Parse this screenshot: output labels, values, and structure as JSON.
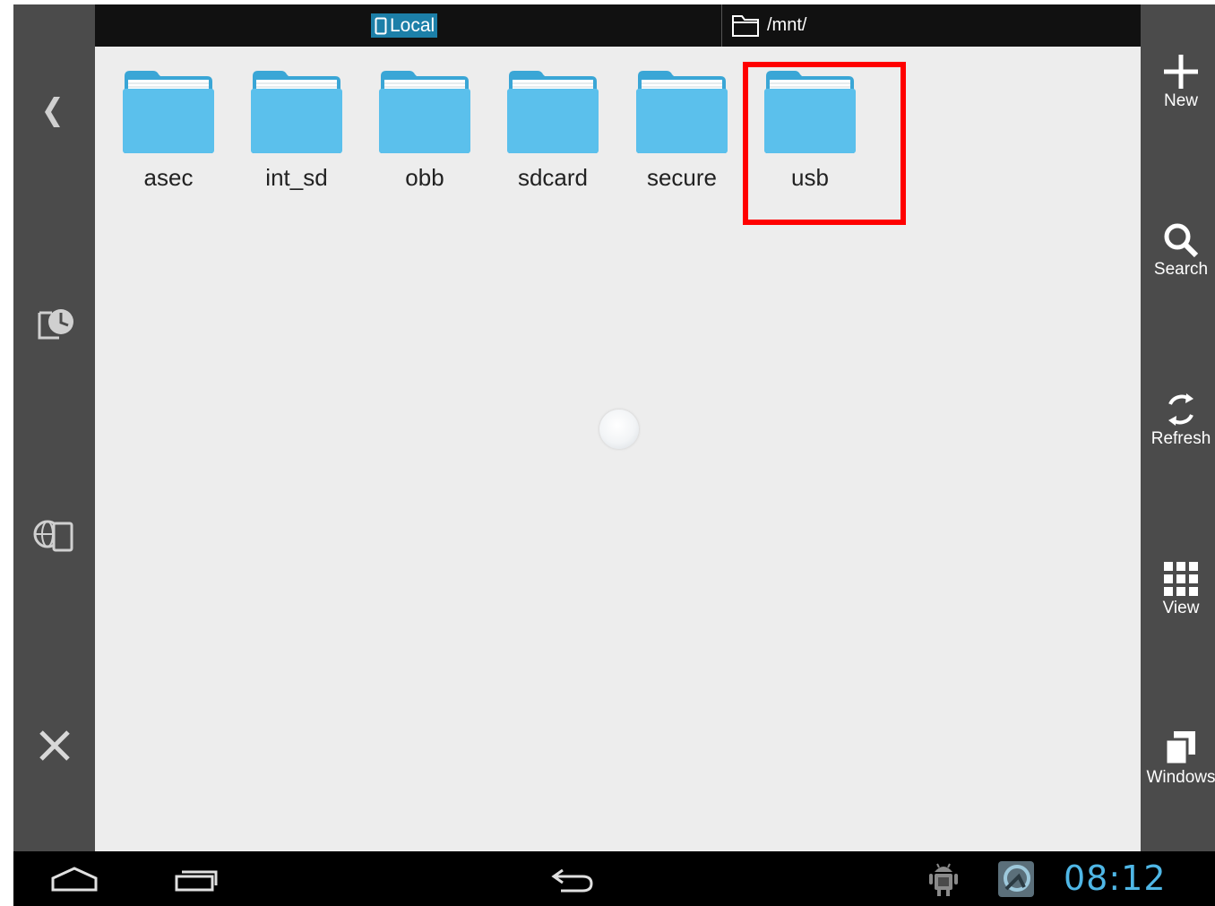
{
  "header": {
    "tab_local_label": "Local",
    "path": "/mnt/"
  },
  "folders": [
    {
      "name": "asec"
    },
    {
      "name": "int_sd"
    },
    {
      "name": "obb"
    },
    {
      "name": "sdcard"
    },
    {
      "name": "secure"
    },
    {
      "name": "usb"
    }
  ],
  "left_bar": {
    "icons": [
      "back-chevron-icon",
      "recent-history-icon",
      "network-icon",
      "close-icon"
    ]
  },
  "right_bar": {
    "new_label": "New",
    "search_label": "Search",
    "refresh_label": "Refresh",
    "view_label": "View",
    "windows_label": "Windows"
  },
  "status_bar": {
    "time": "08:12",
    "icons": [
      "home-icon",
      "recent-apps-icon",
      "back-icon",
      "android-debug-icon",
      "app-notification-icon"
    ]
  },
  "colors": {
    "sidebar": "#4b4b4b",
    "content_bg": "#ededed",
    "folder_blue": "#5bc0ec",
    "local_tab": "#1c7fa8",
    "highlight": "#ff0000",
    "clock": "#4fb7e6"
  }
}
